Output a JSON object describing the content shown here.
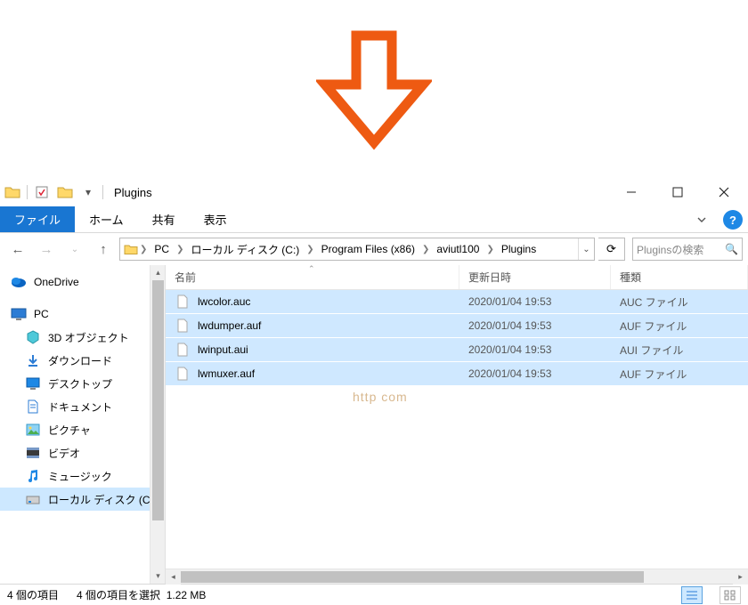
{
  "window_title": "Plugins",
  "ribbon": {
    "file": "ファイル",
    "home": "ホーム",
    "share": "共有",
    "view": "表示"
  },
  "breadcrumb": [
    "PC",
    "ローカル ディスク (C:)",
    "Program Files (x86)",
    "aviutl100",
    "Plugins"
  ],
  "search": {
    "placeholder": "Pluginsの検索"
  },
  "columns": {
    "name": "名前",
    "date": "更新日時",
    "type": "種類"
  },
  "files": [
    {
      "name": "lwcolor.auc",
      "date": "2020/01/04 19:53",
      "type": "AUC ファイル"
    },
    {
      "name": "lwdumper.auf",
      "date": "2020/01/04 19:53",
      "type": "AUF ファイル"
    },
    {
      "name": "lwinput.aui",
      "date": "2020/01/04 19:53",
      "type": "AUI ファイル"
    },
    {
      "name": "lwmuxer.auf",
      "date": "2020/01/04 19:53",
      "type": "AUF ファイル"
    }
  ],
  "nav": {
    "onedrive": "OneDrive",
    "pc": "PC",
    "items": [
      "3D オブジェクト",
      "ダウンロード",
      "デスクトップ",
      "ドキュメント",
      "ピクチャ",
      "ビデオ",
      "ミュージック",
      "ローカル ディスク (C:)"
    ]
  },
  "status": {
    "count": "4 個の項目",
    "selection": "4 個の項目を選択",
    "size": "1.22 MB"
  },
  "help": "?"
}
